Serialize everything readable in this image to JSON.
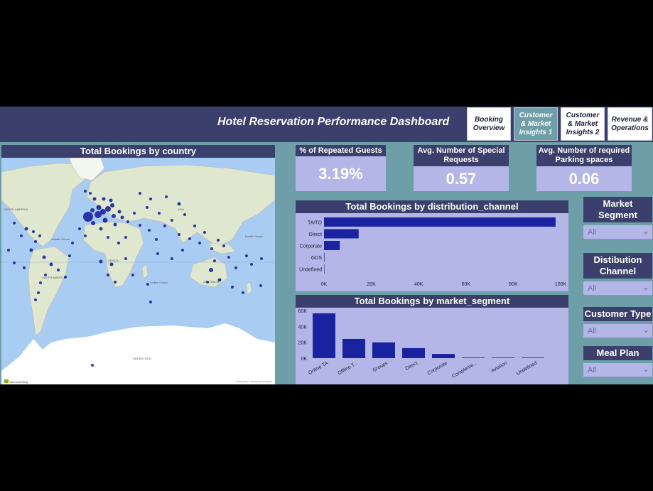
{
  "header": {
    "title": "Hotel Reservation Performance Dashboard",
    "tabs": [
      {
        "label": "Booking Overview",
        "active": false
      },
      {
        "label": "Customer & Market Insights 1",
        "active": true
      },
      {
        "label": "Customer & Market Insights 2",
        "active": false
      },
      {
        "label": "Revenue & Operations",
        "active": false
      }
    ]
  },
  "map": {
    "title": "Total Bookings by country",
    "labels": {
      "north_america": "NORTH AMERICA",
      "south_america": "SOUTH AMERICA",
      "australia": "AUSTRALIA",
      "antarctica": "ANTARCTICA",
      "asia": "ASIA",
      "africa": "AFRICA",
      "atlantic": "Atlantic Ocean",
      "pacific": "Pacific Ocean",
      "indian": "Indian Ocean"
    },
    "attribution": "Microsoft Bing",
    "copyright": "©2024 TomTom, ©2024 Microsoft Corporation",
    "colors": {
      "water": "#a9cdf2",
      "land": "#dfe8cf",
      "ice": "#ffffff",
      "bubble": "#1a239f"
    }
  },
  "kpis": [
    {
      "title": "% of Repeated Guests",
      "value": "3.19%"
    },
    {
      "title": "Avg. Number of Special Requests",
      "value": "0.57"
    },
    {
      "title": "Avg. Number of required Parking spaces",
      "value": "0.06"
    }
  ],
  "slicers": [
    {
      "title": "Market Segment",
      "value": "All"
    },
    {
      "title": "Distibution Channel",
      "value": "All"
    },
    {
      "title": "Customer Type",
      "value": "All"
    },
    {
      "title": "Meal Plan",
      "value": "All"
    }
  ],
  "chart_data": [
    {
      "type": "bar",
      "orientation": "horizontal",
      "title": "Total Bookings by distribution_channel",
      "categories": [
        "TA/TO",
        "Direct",
        "Corporate",
        "GDS",
        "Undefined"
      ],
      "values": [
        97870,
        14645,
        6677,
        193,
        5
      ],
      "xlim": [
        0,
        100000
      ],
      "ticks": [
        "0K",
        "20K",
        "40K",
        "60K",
        "80K",
        "100K"
      ],
      "color": "#1a239f"
    },
    {
      "type": "bar",
      "orientation": "vertical",
      "title": "Total Bookings by market_segment",
      "categories": [
        "Online TA",
        "Offline T...",
        "Groups",
        "Direct",
        "Corporate",
        "Compleme...",
        "Aviation",
        "Undefined"
      ],
      "values": [
        56477,
        24219,
        19811,
        12606,
        5295,
        743,
        237,
        2
      ],
      "ylim": [
        0,
        60000
      ],
      "ticks": [
        "0K",
        "20K",
        "40K",
        "60K"
      ],
      "color": "#1a239f"
    }
  ]
}
